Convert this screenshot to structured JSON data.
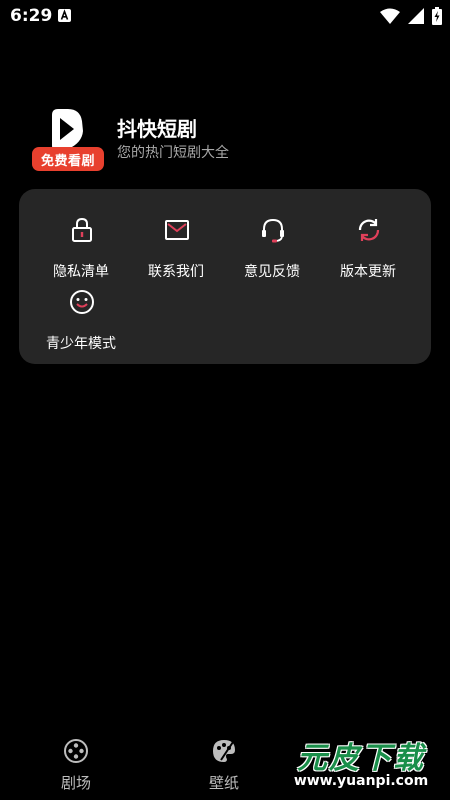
{
  "status_bar": {
    "time": "6:29",
    "icons": [
      "notification-a-icon",
      "wifi-icon",
      "signal-icon",
      "battery-charging-icon"
    ]
  },
  "app": {
    "logo_badge": "免费看剧",
    "name": "抖快短剧",
    "subtitle": "您的热门短剧大全"
  },
  "menu": {
    "items": [
      {
        "label": "隐私清单",
        "icon": "lock-icon"
      },
      {
        "label": "联系我们",
        "icon": "mail-icon"
      },
      {
        "label": "意见反馈",
        "icon": "headset-icon"
      },
      {
        "label": "版本更新",
        "icon": "refresh-icon"
      },
      {
        "label": "青少年模式",
        "icon": "smile-icon"
      }
    ]
  },
  "bottom_nav": {
    "items": [
      {
        "label": "剧场",
        "icon": "film-reel-icon"
      },
      {
        "label": "壁纸",
        "icon": "palette-icon"
      }
    ]
  },
  "watermark": {
    "text": "元皮下载",
    "url": "www.yuanpi.com"
  },
  "colors": {
    "background": "#000000",
    "card": "#262626",
    "accent": "#e8402e",
    "icon_accent": "#e0405a"
  }
}
